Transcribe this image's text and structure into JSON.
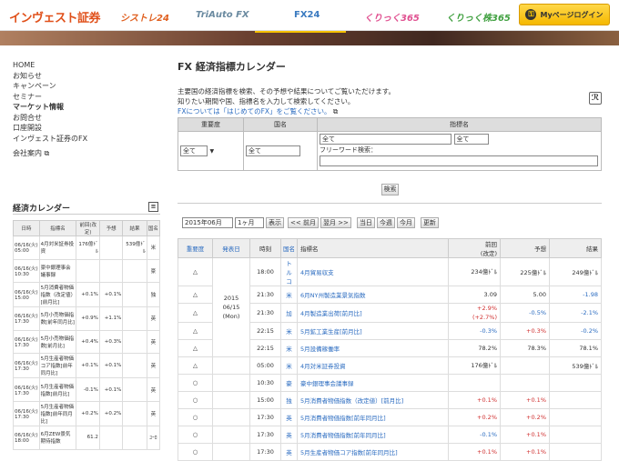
{
  "header": {
    "logo": "インヴェスト証券",
    "nav": [
      "シストレ24",
      "TriAuto FX",
      "FX24",
      "くりっく365",
      "くりっく株365"
    ],
    "mypage": "Myページログイン"
  },
  "sidebar": {
    "items": [
      "HOME",
      "お知らせ",
      "キャンペーン",
      "セミナー",
      "マーケット情報",
      "お問合せ",
      "口座開設",
      "インヴェスト証券のFX",
      "会社案内"
    ],
    "calendar_title": "経済カレンダー",
    "cal_headers": [
      "日時",
      "指標名",
      "前回(改定)",
      "予想",
      "結果",
      "国名"
    ],
    "cal_rows": [
      {
        "dt": "06/16(火) 05:00",
        "name": "4月対米証券投資",
        "prev": "176億ﾄﾞﾙ",
        "fc": "",
        "res": "539億ﾄﾞﾙ",
        "cty": "米"
      },
      {
        "dt": "06/16(火) 10:30",
        "name": "豪中銀理事会議事録",
        "prev": "",
        "fc": "",
        "res": "",
        "cty": "豪"
      },
      {
        "dt": "06/16(火) 15:00",
        "name": "5月消費者物価指数（改定値）[前月比]",
        "prev": "+0.1%",
        "fc": "+0.1%",
        "res": "",
        "cty": "独"
      },
      {
        "dt": "06/16(火) 17:30",
        "name": "5月小売物価指数[前年同月比]",
        "prev": "+0.9%",
        "fc": "+1.1%",
        "res": "",
        "cty": "英"
      },
      {
        "dt": "06/16(火) 17:30",
        "name": "5月小売物価指数[前月比]",
        "prev": "+0.4%",
        "fc": "+0.3%",
        "res": "",
        "cty": "英"
      },
      {
        "dt": "06/16(火) 17:30",
        "name": "5月生産者物価コア指数[前年同月比]",
        "prev": "+0.1%",
        "fc": "+0.1%",
        "res": "",
        "cty": "英"
      },
      {
        "dt": "06/16(火) 17:30",
        "name": "5月生産者物価指数[前月比]",
        "prev": "-0.1%",
        "fc": "+0.1%",
        "res": "",
        "cty": "英"
      },
      {
        "dt": "06/16(火) 17:30",
        "name": "5月生産者物価指数[前年同月比]",
        "prev": "+0.2%",
        "fc": "+0.2%",
        "res": "",
        "cty": "英"
      },
      {
        "dt": "06/16(火) 18:00",
        "name": "6月ZEW景気期待指数",
        "prev": "61.2",
        "fc": "",
        "res": "",
        "cty": "ﾕｰﾛ"
      }
    ]
  },
  "main": {
    "title": "FX 経済指標カレンダー",
    "intro1": "主要国の経済指標を検索、その予想や結果についてご覧いただけます。",
    "intro2": "知りたい期間や国、指標名を入力して検索してください。",
    "intro_link": "FXについては「はじめてのFX」をご覧ください。",
    "search": {
      "h_importance": "重要度",
      "h_country": "国名",
      "h_indicator": "指標名",
      "sel_importance": "全て",
      "sel_country": "全て",
      "sel_ind1": "全て",
      "sel_ind2": "全て",
      "free_label": "フリーワード検索：",
      "button": "検索"
    },
    "controls": {
      "month": "2015年06月",
      "period": "1ヶ月",
      "show": "表示",
      "prev": "<< 前月",
      "next": "翌月 >>",
      "today": "当日",
      "thisweek": "今週",
      "thismonth": "今月",
      "refresh": "更新"
    },
    "table": {
      "headers": [
        "重要度",
        "発表日",
        "時刻",
        "国名",
        "指標名",
        "前回\n(改定)",
        "予想",
        "結果"
      ],
      "date_cell": "2015\n06/15\n(Mon)",
      "rows": [
        {
          "imp": "△",
          "time": "18:00",
          "cty": "トルコ",
          "name": "4月貿易収支",
          "prev": "234億ﾄﾞﾙ",
          "fc": "225億ﾄﾞﾙ",
          "res": "249億ﾄﾞﾙ",
          "pc": "",
          "fcc": "",
          "rc": ""
        },
        {
          "imp": "△",
          "time": "21:30",
          "cty": "米",
          "name": "6月NY州製造業景気指数",
          "prev": "3.09",
          "fc": "5.00",
          "res": "-1.98",
          "pc": "",
          "fcc": "",
          "rc": "blue"
        },
        {
          "imp": "△",
          "time": "21:30",
          "cty": "加",
          "name": "4月製造業出荷[前月比]",
          "prev": "+2.9%\n(+2.7%)",
          "fc": "-0.5%",
          "res": "-2.1%",
          "pc": "red",
          "fcc": "blue",
          "rc": "blue"
        },
        {
          "imp": "△",
          "time": "22:15",
          "cty": "米",
          "name": "5月鉱工業生産[前月比]",
          "prev": "-0.3%",
          "fc": "+0.3%",
          "res": "-0.2%",
          "pc": "blue",
          "fcc": "red",
          "rc": "blue"
        },
        {
          "imp": "△",
          "time": "22:15",
          "cty": "米",
          "name": "5月設備稼働率",
          "prev": "78.2%",
          "fc": "78.3%",
          "res": "78.1%",
          "pc": "",
          "fcc": "",
          "rc": ""
        },
        {
          "imp": "△",
          "time": "05:00",
          "cty": "米",
          "name": "4月対米証券投資",
          "prev": "176億ﾄﾞﾙ",
          "fc": "",
          "res": "539億ﾄﾞﾙ",
          "pc": "",
          "fcc": "",
          "rc": ""
        },
        {
          "imp": "○",
          "time": "10:30",
          "cty": "豪",
          "name": "豪中銀理事会議事録",
          "prev": "",
          "fc": "",
          "res": "",
          "pc": "",
          "fcc": "",
          "rc": ""
        },
        {
          "imp": "○",
          "time": "15:00",
          "cty": "独",
          "name": "5月消費者物価指数（改定値）[前月比]",
          "prev": "+0.1%",
          "fc": "+0.1%",
          "res": "",
          "pc": "red",
          "fcc": "red",
          "rc": ""
        },
        {
          "imp": "○",
          "time": "17:30",
          "cty": "英",
          "name": "5月消費者物価指数[前年同月比]",
          "prev": "+0.2%",
          "fc": "+0.2%",
          "res": "",
          "pc": "red",
          "fcc": "red",
          "rc": ""
        },
        {
          "imp": "○",
          "time": "17:30",
          "cty": "英",
          "name": "5月消費者物価指数[前年同月比]",
          "prev": "-0.1%",
          "fc": "+0.1%",
          "res": "",
          "pc": "blue",
          "fcc": "red",
          "rc": ""
        },
        {
          "imp": "○",
          "time": "17:30",
          "cty": "英",
          "name": "5月生産者物価コア指数[前年同月比]",
          "prev": "+0.1%",
          "fc": "+0.1%",
          "res": "",
          "pc": "red",
          "fcc": "red",
          "rc": ""
        }
      ]
    }
  }
}
